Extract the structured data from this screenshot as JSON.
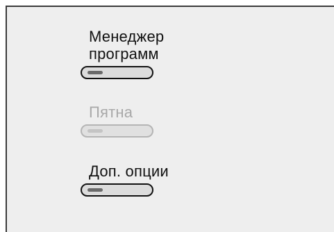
{
  "menu": {
    "items": [
      {
        "label_lines": [
          "Менеджер",
          "программ"
        ],
        "enabled": true
      },
      {
        "label": "Пятна",
        "enabled": false
      },
      {
        "label": "Доп. опции",
        "enabled": true
      }
    ]
  },
  "colors": {
    "background": "#eeeeee",
    "text": "#111111",
    "text_disabled": "#a8a8a8",
    "border": "#3a3a3a"
  },
  "icons": {
    "toggle": "pill-slider"
  }
}
